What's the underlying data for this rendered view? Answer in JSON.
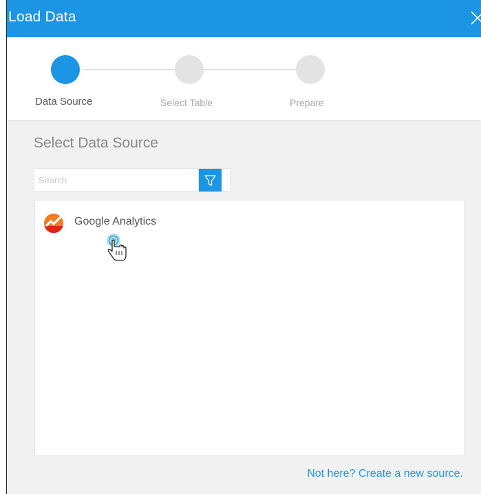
{
  "dialog": {
    "title": "Load Data",
    "accent_color": "#1c95e4"
  },
  "stepper": {
    "steps": [
      {
        "label": "Data Source",
        "state": "active"
      },
      {
        "label": "Select Table",
        "state": "inactive"
      },
      {
        "label": "Prepare",
        "state": "inactive"
      }
    ]
  },
  "main": {
    "heading": "Select Data Source",
    "search": {
      "placeholder": "Search",
      "value": ""
    },
    "sources": [
      {
        "label": "Google Analytics",
        "icon": "google-analytics-icon"
      }
    ],
    "create_link": "Not here? Create a new source."
  },
  "icons": {
    "close": "close-icon",
    "filter": "filter-icon",
    "cursor": "hand-pointer-icon"
  }
}
